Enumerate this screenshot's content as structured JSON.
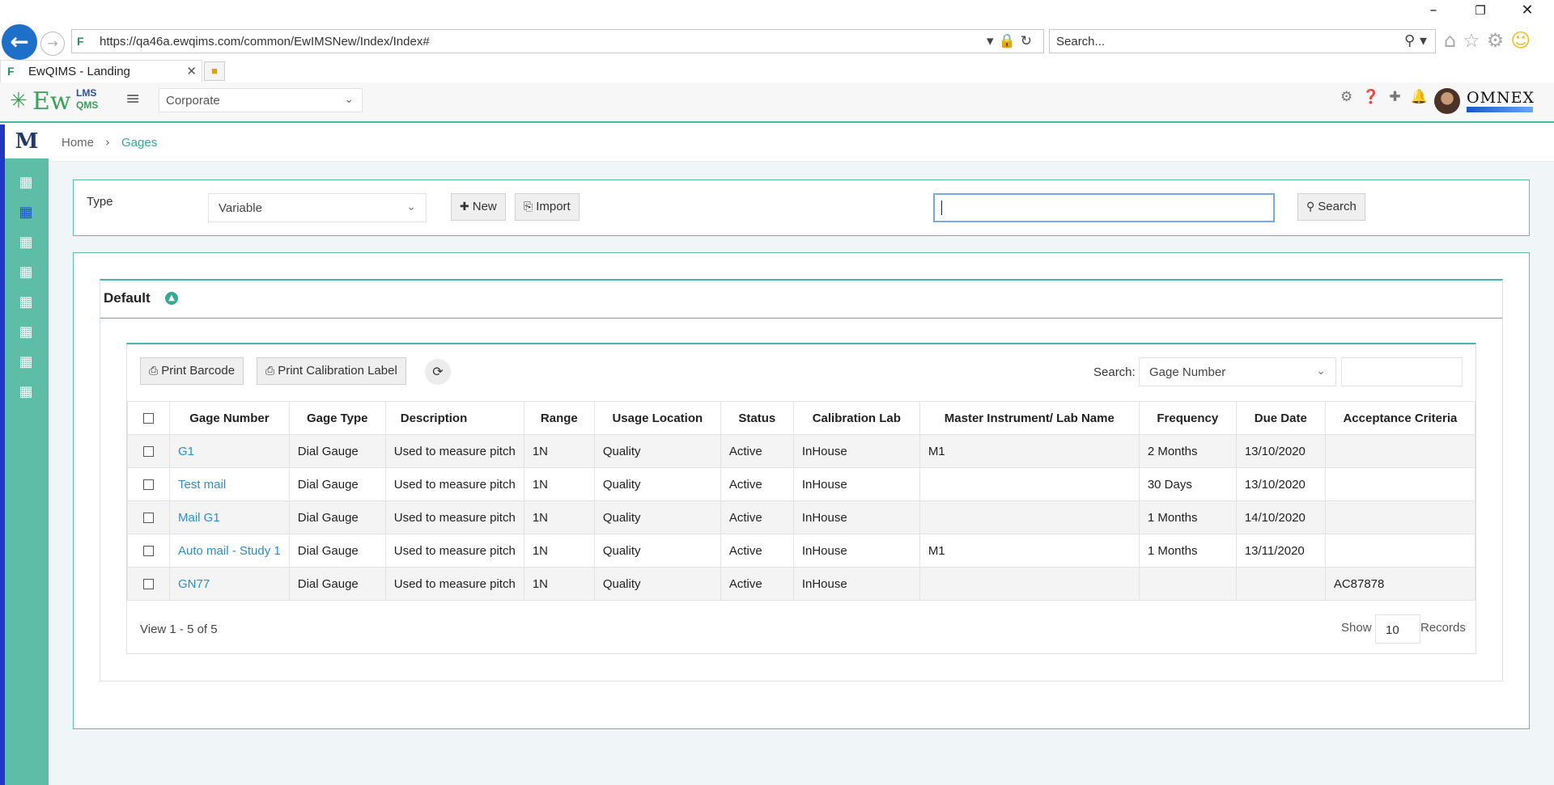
{
  "browser": {
    "url": "https://qa46a.ewqims.com/common/EwIMSNew/Index/Index#",
    "search_placeholder": "Search...",
    "tab_title": "EwQIMS - Landing"
  },
  "header": {
    "logo_main": "Ew",
    "logo_lms": "LMS",
    "logo_qms": "QMS",
    "org_select": "Corporate",
    "brand": "OMNEX"
  },
  "rail": {
    "logo": "M"
  },
  "breadcrumb": {
    "home": "Home",
    "current": "Gages"
  },
  "filter": {
    "type_label": "Type",
    "type_value": "Variable",
    "new_label": "New",
    "import_label": "Import",
    "search_value": "",
    "search_label": "Search"
  },
  "panel": {
    "title": "Default",
    "print_barcode": "Print Barcode",
    "print_calibration": "Print Calibration Label",
    "search_label": "Search:",
    "search_field": "Gage Number",
    "search_value": ""
  },
  "table": {
    "columns": [
      "Gage Number",
      "Gage Type",
      "Description",
      "Range",
      "Usage Location",
      "Status",
      "Calibration Lab",
      "Master Instrument/ Lab Name",
      "Frequency",
      "Due Date",
      "Acceptance Criteria"
    ],
    "rows": [
      [
        "G1",
        "Dial Gauge",
        "Used to measure pitch",
        "1N",
        "Quality",
        "Active",
        "InHouse",
        "M1",
        "2 Months",
        "13/10/2020",
        ""
      ],
      [
        "Test mail",
        "Dial Gauge",
        "Used to measure pitch",
        "1N",
        "Quality",
        "Active",
        "InHouse",
        "",
        "30 Days",
        "13/10/2020",
        ""
      ],
      [
        "Mail G1",
        "Dial Gauge",
        "Used to measure pitch",
        "1N",
        "Quality",
        "Active",
        "InHouse",
        "",
        "1 Months",
        "14/10/2020",
        ""
      ],
      [
        "Auto mail - Study 1",
        "Dial Gauge",
        "Used to measure pitch",
        "1N",
        "Quality",
        "Active",
        "InHouse",
        "M1",
        "1 Months",
        "13/11/2020",
        ""
      ],
      [
        "GN77",
        "Dial Gauge",
        "Used to measure pitch",
        "1N",
        "Quality",
        "Active",
        "InHouse",
        "",
        "",
        "",
        "AC87878"
      ]
    ]
  },
  "footer": {
    "view_text": "View 1 - 5 of 5",
    "show_label": "Show",
    "page_size": "10",
    "records_label": "Records"
  },
  "colors": {
    "accent": "#47b8a8",
    "rail": "#5dbda6",
    "link": "#2a8fc8",
    "back_button": "#1e6fc8"
  }
}
